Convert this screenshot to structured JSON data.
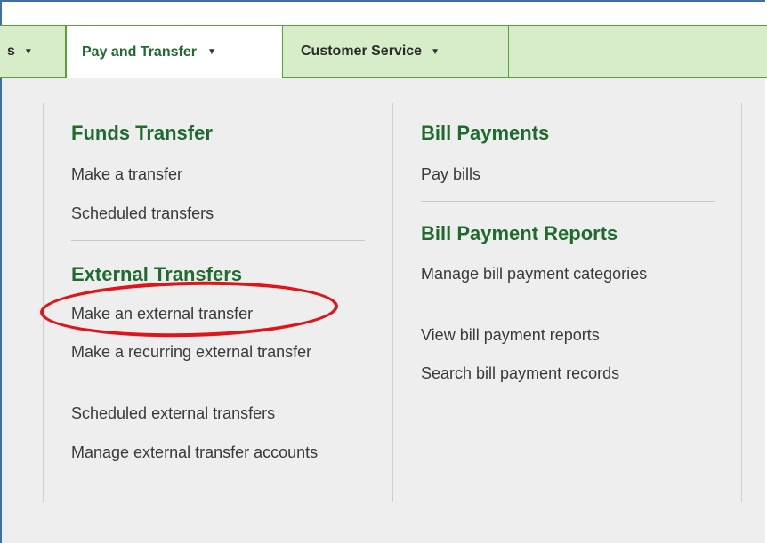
{
  "nav": {
    "tabs": [
      {
        "label": "s",
        "caret": "▼"
      },
      {
        "label": "Pay and Transfer",
        "caret": "▼"
      },
      {
        "label": "Customer Service",
        "caret": "▼"
      }
    ]
  },
  "menu": {
    "left": {
      "funds_transfer": {
        "heading": "Funds Transfer",
        "items": [
          "Make a transfer",
          "Scheduled transfers"
        ]
      },
      "external_transfers": {
        "heading": "External Transfers",
        "items": [
          "Make an external transfer",
          "Make a recurring external transfer",
          "Scheduled external transfers",
          "Manage external transfer accounts"
        ]
      }
    },
    "right": {
      "bill_payments": {
        "heading": "Bill Payments",
        "items": [
          "Pay bills"
        ]
      },
      "bill_payment_reports": {
        "heading": "Bill Payment Reports",
        "items": [
          "Manage bill payment categories",
          "View bill payment reports",
          "Search bill payment records"
        ]
      }
    }
  },
  "colors": {
    "nav_bg": "#d7ecc8",
    "nav_border": "#5aa03a",
    "heading": "#1f6b2e",
    "annotation": "#e0151a"
  }
}
